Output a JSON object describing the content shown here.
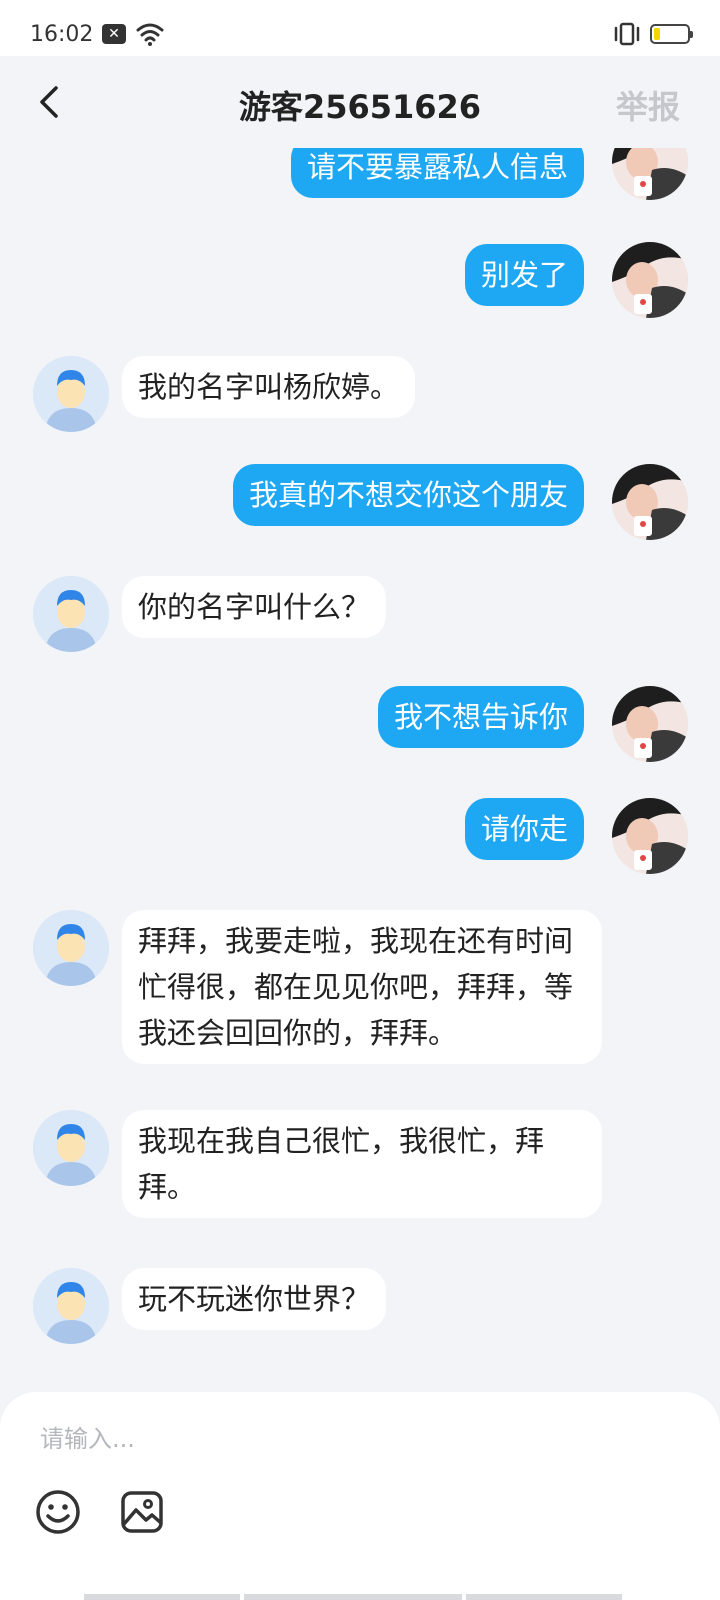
{
  "status_bar": {
    "time": "16:02"
  },
  "header": {
    "title": "游客25651626",
    "report": "举报"
  },
  "messages": [
    {
      "side": "out",
      "text": "请不要暴露私人信息"
    },
    {
      "side": "out",
      "text": "别发了"
    },
    {
      "side": "in",
      "text": "我的名字叫杨欣婷。"
    },
    {
      "side": "out",
      "text": "我真的不想交你这个朋友"
    },
    {
      "side": "in",
      "text": "你的名字叫什么？"
    },
    {
      "side": "out",
      "text": "我不想告诉你"
    },
    {
      "side": "out",
      "text": "请你走"
    },
    {
      "side": "in",
      "text": "拜拜，我要走啦，我现在还有时间忙得很，都在见见你吧，拜拜，等我还会回回你的，拜拜。"
    },
    {
      "side": "in",
      "text": "我现在我自己很忙，我很忙，拜拜。"
    },
    {
      "side": "in",
      "text": "玩不玩迷你世界？"
    }
  ],
  "input": {
    "placeholder": "请输入..."
  },
  "icons": {
    "back": "chevron-left-icon",
    "emoji": "smiley-icon",
    "image": "image-icon"
  },
  "colors": {
    "outgoing_bubble": "#1ea7f3",
    "incoming_bubble": "#ffffff",
    "background": "#f2f4f7"
  }
}
